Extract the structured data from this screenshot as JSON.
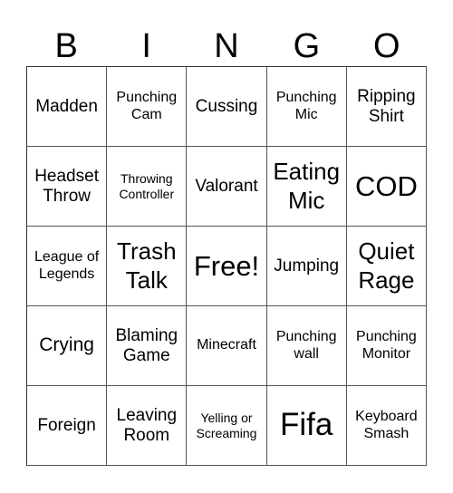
{
  "header": [
    "B",
    "I",
    "N",
    "G",
    "O"
  ],
  "cells": [
    [
      "Madden",
      "Punching Cam",
      "Cussing",
      "Punching Mic",
      "Ripping Shirt"
    ],
    [
      "Headset Throw",
      "Throwing Controller",
      "Valorant",
      "Eating Mic",
      "COD"
    ],
    [
      "League of Legends",
      "Trash Talk",
      "Free!",
      "Jumping",
      "Quiet Rage"
    ],
    [
      "Crying",
      "Blaming Game",
      "Minecraft",
      "Punching wall",
      "Punching Monitor"
    ],
    [
      "Foreign",
      "Leaving Room",
      "Yelling or Screaming",
      "Fifa",
      "Keyboard Smash"
    ]
  ]
}
